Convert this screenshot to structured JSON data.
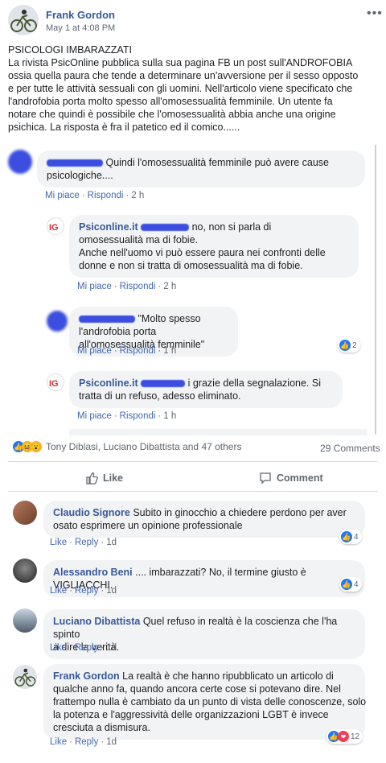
{
  "post": {
    "author": "Frank Gordon",
    "date": "May 1 at 4:08 PM",
    "title": "PSICOLOGI IMBARAZZATI",
    "lines": [
      "La rivista PsicOnline pubblica sulla sua pagina FB un post sull'ANDROFOBIA",
      "ossia quella paura che tende a determinare un'avversione per il sesso opposto",
      "e per tutte le attività sessuali con gli uomini. Nell'articolo viene specificato che",
      "l'androfobia porta molto spesso all'omosessualità femminile. Un utente fa",
      "notare che quindi è possibile che l'omosessualità abbia anche una origine",
      "psichica. La risposta è fra il patetico ed il comico......"
    ]
  },
  "embedded": {
    "c1": {
      "text1": "Quindi l'omosessualità femminile può avere cause",
      "text2": "psicologiche....",
      "like": "Mi piace",
      "reply": "Rispondi",
      "time": "2 h"
    },
    "c2": {
      "name": "Psiconline.it",
      "text1": "no, non si parla di",
      "text2": "omosessualità ma di fobie.",
      "text3": "Anche nell'uomo vi può essere paura nei confronti delle",
      "text4": "donne e non si tratta di omosessualità ma di fobie.",
      "like": "Mi piace",
      "reply": "Rispondi",
      "time": "2 h"
    },
    "c3": {
      "text1": "\"Molto spesso l'androfobia porta",
      "text2": "all'omosessualità femminile\"",
      "like": "Mi piace",
      "reply": "Rispondi",
      "time": "1 h",
      "reactions": "2"
    },
    "c4": {
      "name": "Psiconline.it",
      "text1": "i grazie della segnalazione. Si",
      "text2": "tratta di un refuso, adesso eliminato.",
      "like": "Mi piace",
      "reply": "Rispondi",
      "time": "1 h"
    }
  },
  "summary": {
    "reactors": "Tony Diblasi, Luciano Dibattista and 47 others",
    "comments": "29 Comments"
  },
  "buttons": {
    "like": "Like",
    "comment": "Comment"
  },
  "comments": [
    {
      "name": "Claudio Signore",
      "line1": "Subito in ginocchio a chiedere perdono per aver",
      "line2": "osato esprimere un opinione professionale",
      "like": "Like",
      "reply": "Reply",
      "time": "1d",
      "reactions": "4"
    },
    {
      "name": "Alessandro Beni",
      "line1": ".... imbarazzati? No, il termine giusto è VIGLIACCHI.",
      "like": "Like",
      "reply": "Reply",
      "time": "1d",
      "reactions": "4"
    },
    {
      "name": "Luciano Dibattista",
      "line1": "Quel refuso in realtà è la coscienza che l'ha spinto",
      "line2": "a dire la verità.",
      "like": "Like",
      "reply": "Reply",
      "time": "1d"
    },
    {
      "name": "Frank Gordon",
      "line1": "La realtà è che hanno ripubblicato un articolo di",
      "line2": "qualche anno fa, quando ancora certe cose si potevano dire. Nel",
      "line3": "frattempo nulla è cambiato da un punto di vista delle conoscenze, solo",
      "line4": "la potenza e l'aggressività delle organizzazioni LGBT è invece",
      "line5": "cresciuta a dismisura.",
      "like": "Like",
      "reply": "Reply",
      "time": "1d",
      "reactions": "12"
    }
  ],
  "colors": {
    "link": "#385898",
    "action": "#4267b2",
    "bubble": "#f2f3f5",
    "like": "#2078f4",
    "love": "#f33e58"
  }
}
